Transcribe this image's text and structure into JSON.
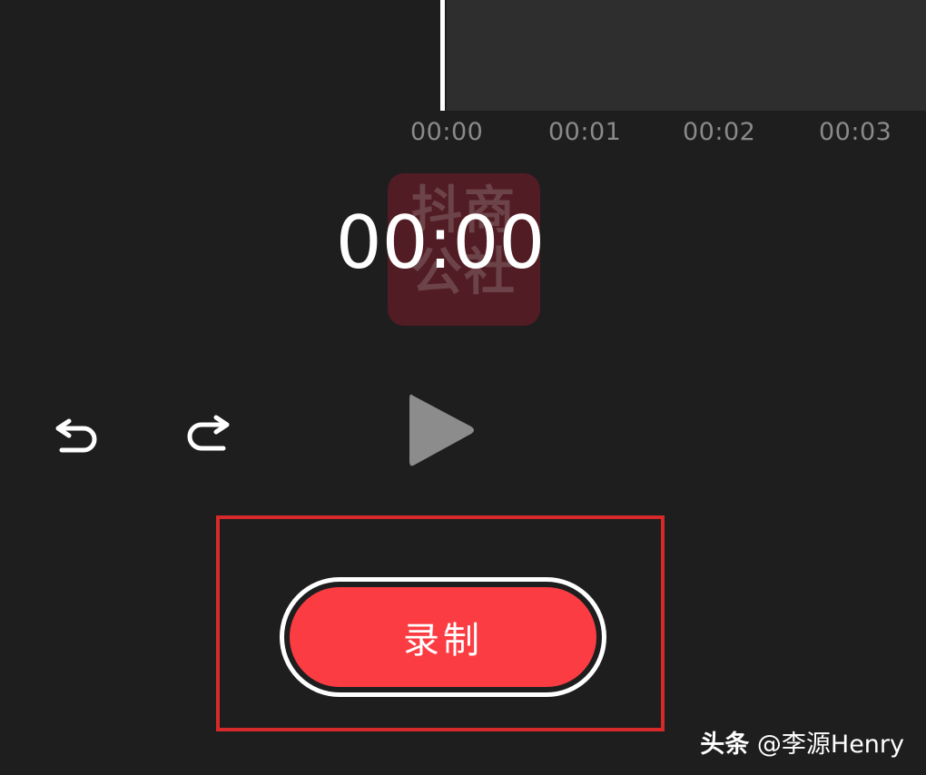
{
  "timeline": {
    "ticks": [
      "00:00",
      "00:01",
      "00:02",
      "00:03"
    ]
  },
  "watermark": {
    "text": "抖商公社"
  },
  "timer": {
    "value": "00:00"
  },
  "controls": {
    "undo_icon": "undo-icon",
    "redo_icon": "redo-icon",
    "play_icon": "play-icon"
  },
  "record_button": {
    "label": "录制",
    "color": "#fb3c42"
  },
  "highlight_color": "#d62a2a",
  "credit": {
    "brand": "头条",
    "author": "@李源Henry"
  }
}
